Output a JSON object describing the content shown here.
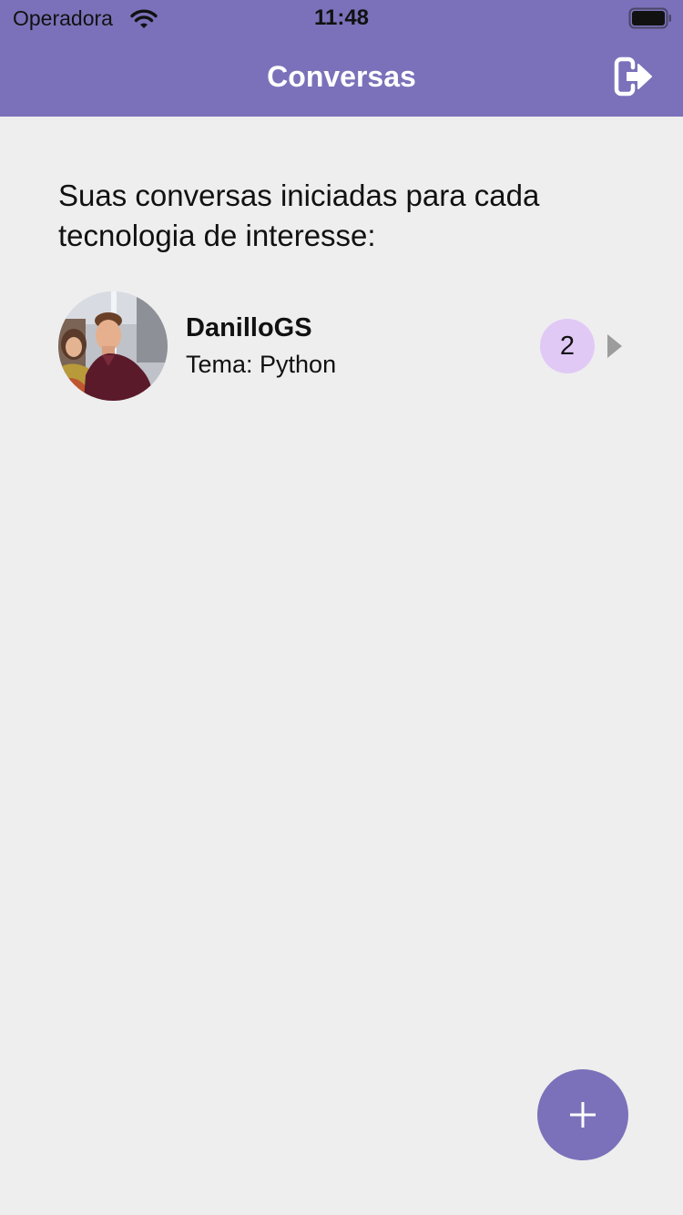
{
  "status_bar": {
    "carrier": "Operadora",
    "time": "11:48",
    "wifi_icon": "wifi-icon",
    "battery_icon": "battery-icon"
  },
  "header": {
    "title": "Conversas",
    "logout_icon": "logout-icon",
    "background_color": "#7B71BA"
  },
  "intro_text": "Suas conversas iniciadas para cada tecnologia de interesse:",
  "conversations": [
    {
      "name": "DanilloGS",
      "topic": "Tema: Python",
      "unread_count": "2",
      "avatar": "user-photo",
      "chevron_icon": "chevron-right-icon"
    }
  ],
  "fab": {
    "icon": "plus-icon",
    "color": "#7B71BA"
  },
  "colors": {
    "accent": "#7B71BA",
    "badge": "#E1C9F6",
    "background": "#EEEEEE"
  }
}
